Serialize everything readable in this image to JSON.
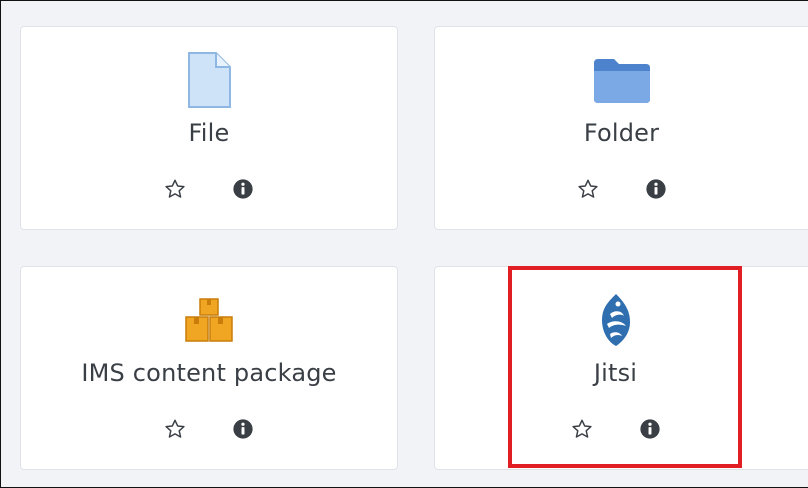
{
  "activities": [
    {
      "id": "file",
      "label": "File",
      "icon": "file-icon"
    },
    {
      "id": "folder",
      "label": "Folder",
      "icon": "folder-icon"
    },
    {
      "id": "ims",
      "label": "IMS content package",
      "icon": "boxes-icon"
    },
    {
      "id": "jitsi",
      "label": "Jitsi",
      "icon": "jitsi-icon"
    }
  ],
  "actions": {
    "star_icon": "star-outline-icon",
    "info_icon": "info-circle-icon"
  },
  "colors": {
    "card_bg": "#ffffff",
    "page_bg": "#f1f3f6",
    "highlight": "#e01e24",
    "folder_blue": "#5b8fd6",
    "file_blue": "#a9cdf2",
    "box_orange": "#f0a623",
    "jitsi_blue": "#2f6fb0"
  },
  "highlighted": "jitsi"
}
